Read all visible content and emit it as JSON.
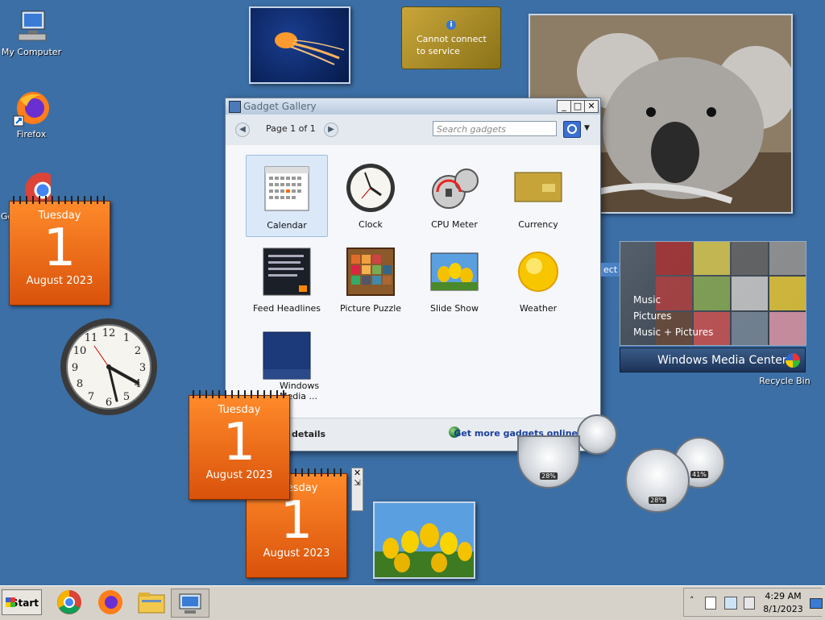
{
  "desktop": {
    "icons": [
      {
        "label": "My Computer"
      },
      {
        "label": "Firefox"
      },
      {
        "label": "Go"
      },
      {
        "label": "Recycle Bin"
      }
    ]
  },
  "calendars": [
    {
      "dow": "Tuesday",
      "day": "1",
      "month_year": "August 2023"
    },
    {
      "dow": "Tuesday",
      "day": "1",
      "month_year": "August 2023"
    },
    {
      "dow": "Tuesday",
      "day": "1",
      "month_year": "August 2023"
    }
  ],
  "currency_gadget": {
    "line1": "Cannot connect",
    "line2": "to service"
  },
  "gallery": {
    "title": "Gadget Gallery",
    "page_label": "Page 1 of 1",
    "search_placeholder": "Search gadgets",
    "tiles": [
      {
        "label": "Calendar"
      },
      {
        "label": "Clock"
      },
      {
        "label": "CPU Meter"
      },
      {
        "label": "Currency"
      },
      {
        "label": "Feed Headlines"
      },
      {
        "label": "Picture Puzzle"
      },
      {
        "label": "Slide Show"
      },
      {
        "label": "Weather"
      },
      {
        "label": "Windows Media ..."
      }
    ],
    "show_details": "details",
    "get_more": "Get more gadgets online"
  },
  "media_center": {
    "menu": [
      "Music",
      "Pictures",
      "Music + Pictures"
    ],
    "brand": "Windows Media Center",
    "peek_label": "ect"
  },
  "cpu_meters": [
    {
      "cpu": "28%",
      "mem": "28%"
    },
    {
      "cpu": "28%",
      "mem": "41%"
    }
  ],
  "taskbar": {
    "start_label": "Start",
    "time": "4:29 AM",
    "date": "8/1/2023"
  },
  "colors": {
    "desktop": "#3c6fa6",
    "calendar": "#e8660f",
    "accent": "#1a3f9e"
  }
}
